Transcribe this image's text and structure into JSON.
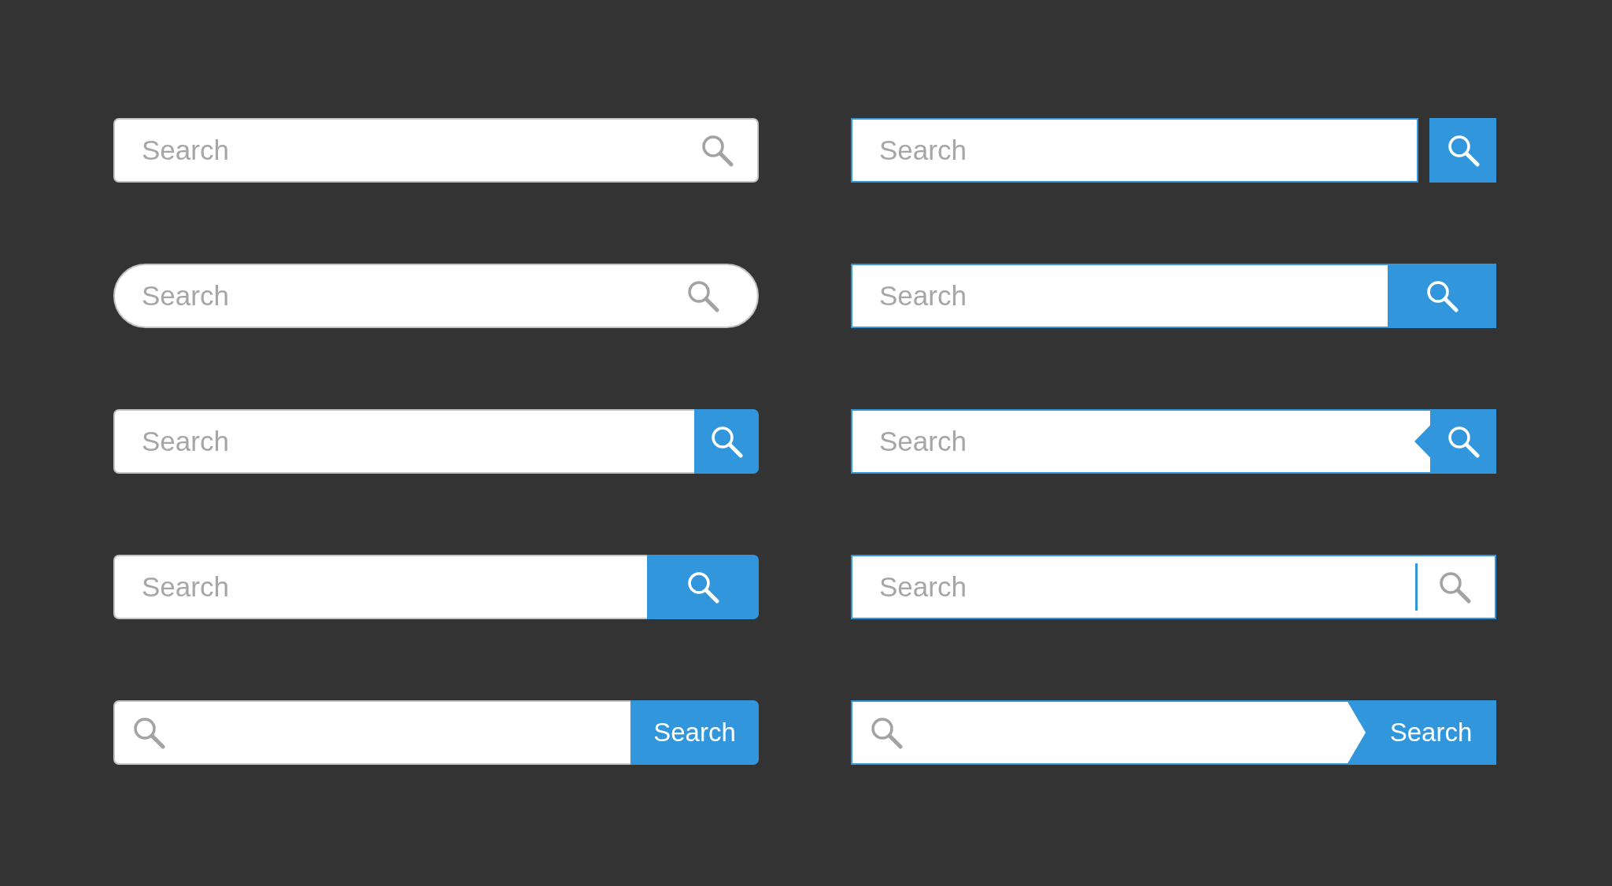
{
  "search_bars": [
    {
      "kind": "rounded-icon",
      "placeholder": "Search"
    },
    {
      "kind": "framed-separate-button",
      "placeholder": "Search"
    },
    {
      "kind": "pill-icon",
      "placeholder": "Search"
    },
    {
      "kind": "framed-joined-button",
      "placeholder": "Search"
    },
    {
      "kind": "rounded-joined-button",
      "placeholder": "Search"
    },
    {
      "kind": "framed-notched-button",
      "placeholder": "Search"
    },
    {
      "kind": "rounded-wide-button",
      "placeholder": "Search"
    },
    {
      "kind": "framed-divider-icon",
      "placeholder": "Search"
    },
    {
      "kind": "rounded-label-button",
      "button_label": "Search"
    },
    {
      "kind": "framed-arrow-button",
      "button_label": "Search"
    }
  ]
}
